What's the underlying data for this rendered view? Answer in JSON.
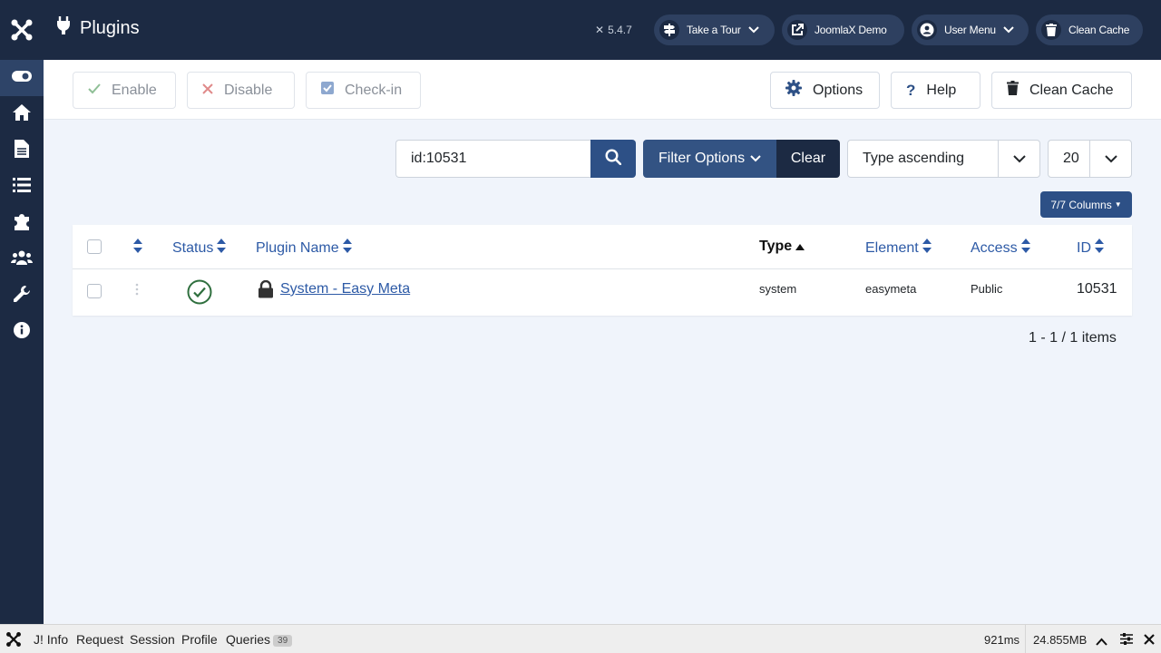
{
  "header": {
    "title": "Plugins",
    "version": "5.4.7",
    "buttons": [
      {
        "label": "Take a Tour",
        "icon": "signpost-icon"
      },
      {
        "label": "JoomlaX Demo",
        "icon": "external-link-icon"
      },
      {
        "label": "User Menu",
        "icon": "user-icon"
      },
      {
        "label": "Clean Cache",
        "icon": "trash-icon"
      }
    ]
  },
  "sidebar": {
    "items": [
      {
        "icon": "toggle-icon"
      },
      {
        "icon": "home-icon"
      },
      {
        "icon": "document-icon"
      },
      {
        "icon": "list-icon"
      },
      {
        "icon": "puzzle-icon"
      },
      {
        "icon": "users-icon"
      },
      {
        "icon": "wrench-icon"
      },
      {
        "icon": "info-icon"
      }
    ]
  },
  "toolbar": {
    "enable": "Enable",
    "disable": "Disable",
    "checkin": "Check-in",
    "options": "Options",
    "help": "Help",
    "clean_cache": "Clean Cache"
  },
  "filters": {
    "search_value": "id:10531",
    "filter_options": "Filter Options",
    "clear": "Clear",
    "ordering": "Type ascending",
    "limit": "20",
    "columns": "7/7 Columns"
  },
  "table": {
    "headers": {
      "status": "Status",
      "name": "Plugin Name",
      "type": "Type",
      "element": "Element",
      "access": "Access",
      "id": "ID"
    },
    "rows": [
      {
        "name": "System - Easy Meta",
        "type": "system",
        "element": "easymeta",
        "access": "Public",
        "id": "10531",
        "enabled": true,
        "locked": true
      }
    ]
  },
  "pagination": "1 - 1 / 1 items",
  "debugbar": {
    "items": [
      "J! Info",
      "Request",
      "Session",
      "Profile",
      "Queries"
    ],
    "queries_count": "39",
    "time": "921ms",
    "memory": "24.855MB"
  },
  "colors": {
    "header_bg": "#1c2a43",
    "primary": "#2d5086",
    "link": "#2d5aa6",
    "success": "#2f6f3e"
  }
}
